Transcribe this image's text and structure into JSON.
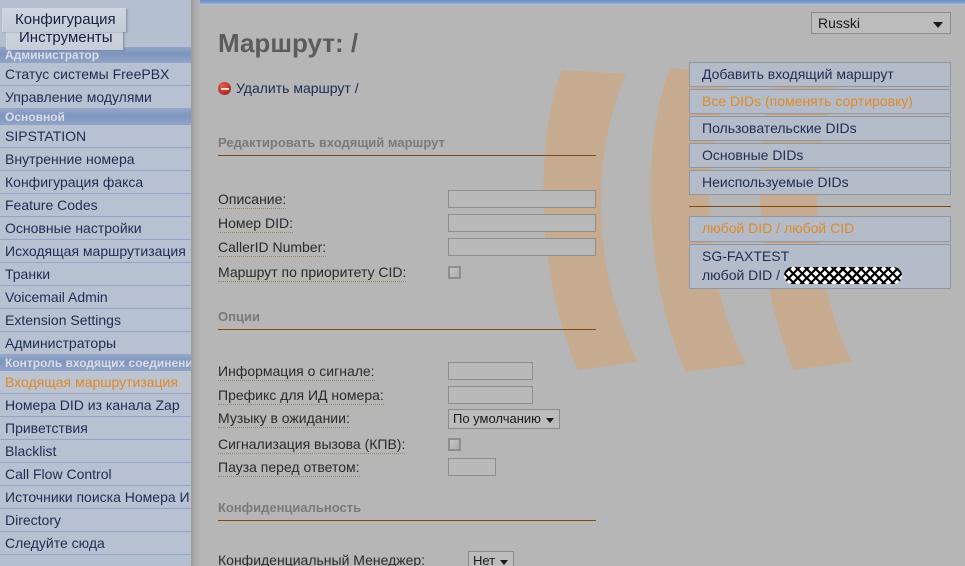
{
  "tabs": [
    {
      "label": "Конфигурация"
    },
    {
      "label": "Инструменты"
    }
  ],
  "sidebar": {
    "items": [
      {
        "type": "section",
        "label": "Администратор"
      },
      {
        "type": "item",
        "label": "Статус системы FreePBX"
      },
      {
        "type": "item",
        "label": "Управление модулями"
      },
      {
        "type": "section",
        "label": "Основной"
      },
      {
        "type": "item",
        "label": "SIPSTATION"
      },
      {
        "type": "item",
        "label": "Внутренние номера"
      },
      {
        "type": "item",
        "label": "Конфигурация факса"
      },
      {
        "type": "item",
        "label": "Feature Codes"
      },
      {
        "type": "item",
        "label": "Основные настройки"
      },
      {
        "type": "item",
        "label": "Исходящая маршрутизация"
      },
      {
        "type": "item",
        "label": "Транки"
      },
      {
        "type": "item",
        "label": "Voicemail Admin"
      },
      {
        "type": "item",
        "label": "Extension Settings"
      },
      {
        "type": "item",
        "label": "Администраторы"
      },
      {
        "type": "section",
        "label": "Контроль входящих соединени"
      },
      {
        "type": "item",
        "label": "Входящая маршрутизация",
        "active": true
      },
      {
        "type": "item",
        "label": "Номера DID из канала Zap"
      },
      {
        "type": "item",
        "label": "Приветствия"
      },
      {
        "type": "item",
        "label": "Blacklist"
      },
      {
        "type": "item",
        "label": "Call Flow Control"
      },
      {
        "type": "item",
        "label": "Источники поиска Номера И"
      },
      {
        "type": "item",
        "label": "Directory"
      },
      {
        "type": "item",
        "label": "Следуйте сюда"
      }
    ]
  },
  "main": {
    "page_title": "Маршрут: /",
    "delete_link": "Удалить маршрут /",
    "sections": [
      {
        "title": "Редактировать входящий маршрут"
      },
      {
        "title": "Опции"
      },
      {
        "title": "Конфиденциальность"
      }
    ],
    "fields": {
      "description_label": "Описание:",
      "description_value": "",
      "did_label": "Номер DID:",
      "did_value": "",
      "callerid_label": "CallerID Number:",
      "callerid_value": "",
      "cid_priority_label": "Маршрут по приоритету CID:",
      "cid_priority_checked": false,
      "alert_info_label": "Информация о сигнале:",
      "alert_info_value": "",
      "cid_prefix_label": "Префикс для ИД номера:",
      "cid_prefix_value": "",
      "moh_label": "Музыку в ожидании:",
      "moh_value": "По умолчанию",
      "ringer_label": "Сигнализация вызова (КПВ):",
      "ringer_checked": false,
      "pause_label": "Пауза перед ответом:",
      "pause_value": "",
      "privacy_manager_label": "Конфиденциальный Менеджер:",
      "privacy_manager_value": "Нет"
    }
  },
  "right": {
    "language_value": "Russki",
    "buttons": [
      {
        "label": "Добавить входящий маршрут",
        "highlight": false
      },
      {
        "label": "Все DIDs (поменять сортировку)",
        "highlight": true
      },
      {
        "label": "Пользовательские DIDs",
        "highlight": false
      },
      {
        "label": "Основные DIDs",
        "highlight": false
      },
      {
        "label": "Неиспользуемые DIDs",
        "highlight": false
      }
    ],
    "routes": [
      {
        "line1": "любой DID / любой CID",
        "line2": "",
        "highlight": true,
        "redacted": false
      },
      {
        "line1": "SG-FAXTEST",
        "line2": "любой DID / ",
        "highlight": false,
        "redacted": true
      }
    ]
  },
  "colors": {
    "accent_orange": "#e08a27",
    "rule_brown": "#7d4a16",
    "nav_blue": "#7e94bd",
    "nav_item_bg": "#b7c1d1",
    "page_bg": "#b6b6b6",
    "watermark_tan": "#c8ab8e"
  }
}
